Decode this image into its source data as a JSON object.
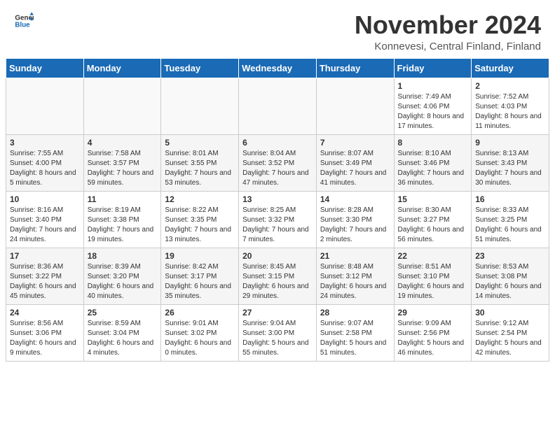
{
  "header": {
    "logo_line1": "General",
    "logo_line2": "Blue",
    "month": "November 2024",
    "location": "Konnevesi, Central Finland, Finland"
  },
  "days_of_week": [
    "Sunday",
    "Monday",
    "Tuesday",
    "Wednesday",
    "Thursday",
    "Friday",
    "Saturday"
  ],
  "weeks": [
    [
      {
        "day": "",
        "info": ""
      },
      {
        "day": "",
        "info": ""
      },
      {
        "day": "",
        "info": ""
      },
      {
        "day": "",
        "info": ""
      },
      {
        "day": "",
        "info": ""
      },
      {
        "day": "1",
        "info": "Sunrise: 7:49 AM\nSunset: 4:06 PM\nDaylight: 8 hours and 17 minutes."
      },
      {
        "day": "2",
        "info": "Sunrise: 7:52 AM\nSunset: 4:03 PM\nDaylight: 8 hours and 11 minutes."
      }
    ],
    [
      {
        "day": "3",
        "info": "Sunrise: 7:55 AM\nSunset: 4:00 PM\nDaylight: 8 hours and 5 minutes."
      },
      {
        "day": "4",
        "info": "Sunrise: 7:58 AM\nSunset: 3:57 PM\nDaylight: 7 hours and 59 minutes."
      },
      {
        "day": "5",
        "info": "Sunrise: 8:01 AM\nSunset: 3:55 PM\nDaylight: 7 hours and 53 minutes."
      },
      {
        "day": "6",
        "info": "Sunrise: 8:04 AM\nSunset: 3:52 PM\nDaylight: 7 hours and 47 minutes."
      },
      {
        "day": "7",
        "info": "Sunrise: 8:07 AM\nSunset: 3:49 PM\nDaylight: 7 hours and 41 minutes."
      },
      {
        "day": "8",
        "info": "Sunrise: 8:10 AM\nSunset: 3:46 PM\nDaylight: 7 hours and 36 minutes."
      },
      {
        "day": "9",
        "info": "Sunrise: 8:13 AM\nSunset: 3:43 PM\nDaylight: 7 hours and 30 minutes."
      }
    ],
    [
      {
        "day": "10",
        "info": "Sunrise: 8:16 AM\nSunset: 3:40 PM\nDaylight: 7 hours and 24 minutes."
      },
      {
        "day": "11",
        "info": "Sunrise: 8:19 AM\nSunset: 3:38 PM\nDaylight: 7 hours and 19 minutes."
      },
      {
        "day": "12",
        "info": "Sunrise: 8:22 AM\nSunset: 3:35 PM\nDaylight: 7 hours and 13 minutes."
      },
      {
        "day": "13",
        "info": "Sunrise: 8:25 AM\nSunset: 3:32 PM\nDaylight: 7 hours and 7 minutes."
      },
      {
        "day": "14",
        "info": "Sunrise: 8:28 AM\nSunset: 3:30 PM\nDaylight: 7 hours and 2 minutes."
      },
      {
        "day": "15",
        "info": "Sunrise: 8:30 AM\nSunset: 3:27 PM\nDaylight: 6 hours and 56 minutes."
      },
      {
        "day": "16",
        "info": "Sunrise: 8:33 AM\nSunset: 3:25 PM\nDaylight: 6 hours and 51 minutes."
      }
    ],
    [
      {
        "day": "17",
        "info": "Sunrise: 8:36 AM\nSunset: 3:22 PM\nDaylight: 6 hours and 45 minutes."
      },
      {
        "day": "18",
        "info": "Sunrise: 8:39 AM\nSunset: 3:20 PM\nDaylight: 6 hours and 40 minutes."
      },
      {
        "day": "19",
        "info": "Sunrise: 8:42 AM\nSunset: 3:17 PM\nDaylight: 6 hours and 35 minutes."
      },
      {
        "day": "20",
        "info": "Sunrise: 8:45 AM\nSunset: 3:15 PM\nDaylight: 6 hours and 29 minutes."
      },
      {
        "day": "21",
        "info": "Sunrise: 8:48 AM\nSunset: 3:12 PM\nDaylight: 6 hours and 24 minutes."
      },
      {
        "day": "22",
        "info": "Sunrise: 8:51 AM\nSunset: 3:10 PM\nDaylight: 6 hours and 19 minutes."
      },
      {
        "day": "23",
        "info": "Sunrise: 8:53 AM\nSunset: 3:08 PM\nDaylight: 6 hours and 14 minutes."
      }
    ],
    [
      {
        "day": "24",
        "info": "Sunrise: 8:56 AM\nSunset: 3:06 PM\nDaylight: 6 hours and 9 minutes."
      },
      {
        "day": "25",
        "info": "Sunrise: 8:59 AM\nSunset: 3:04 PM\nDaylight: 6 hours and 4 minutes."
      },
      {
        "day": "26",
        "info": "Sunrise: 9:01 AM\nSunset: 3:02 PM\nDaylight: 6 hours and 0 minutes."
      },
      {
        "day": "27",
        "info": "Sunrise: 9:04 AM\nSunset: 3:00 PM\nDaylight: 5 hours and 55 minutes."
      },
      {
        "day": "28",
        "info": "Sunrise: 9:07 AM\nSunset: 2:58 PM\nDaylight: 5 hours and 51 minutes."
      },
      {
        "day": "29",
        "info": "Sunrise: 9:09 AM\nSunset: 2:56 PM\nDaylight: 5 hours and 46 minutes."
      },
      {
        "day": "30",
        "info": "Sunrise: 9:12 AM\nSunset: 2:54 PM\nDaylight: 5 hours and 42 minutes."
      }
    ]
  ]
}
